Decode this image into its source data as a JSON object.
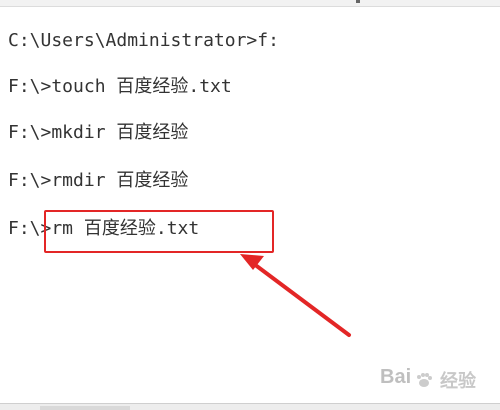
{
  "terminal": {
    "lines": [
      {
        "text": "C:\\Users\\Administrator>f:"
      },
      {
        "text": "F:\\>touch 百度经验.txt"
      },
      {
        "text": "F:\\>mkdir 百度经验"
      },
      {
        "text": "F:\\>rmdir 百度经验"
      },
      {
        "text": "F:\\>rm 百度经验.txt"
      }
    ]
  },
  "annotation": {
    "box_color": "#e32626",
    "arrow_color": "#e32626"
  },
  "watermark": {
    "text": "Bai",
    "subtext": "经验",
    "icon": "baidu-paw-icon"
  }
}
